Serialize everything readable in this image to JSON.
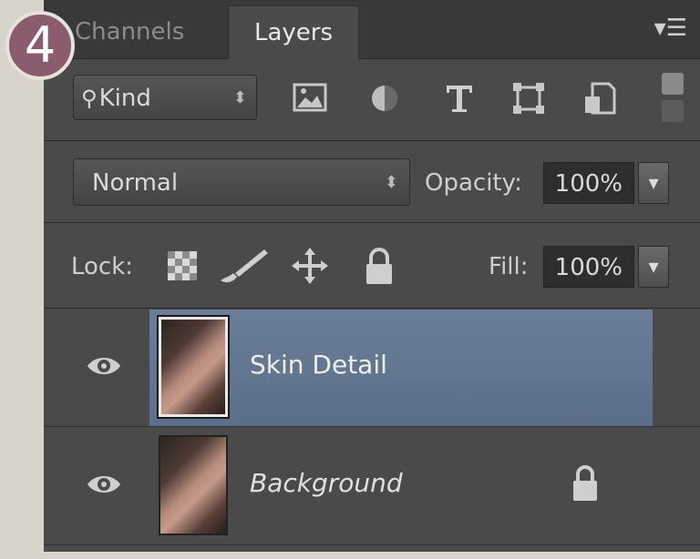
{
  "step_badge": "4",
  "tabs": [
    {
      "label": "Channels",
      "active": false
    },
    {
      "label": "Layers",
      "active": true
    }
  ],
  "panel_menu_icon": "panel-menu-icon",
  "filter": {
    "kind_label": "Kind",
    "icons": [
      "pixel-layer-filter-icon",
      "adjustment-layer-filter-icon",
      "type-layer-filter-icon",
      "shape-layer-filter-icon",
      "smart-object-filter-icon"
    ]
  },
  "blend": {
    "mode": "Normal",
    "opacity_label": "Opacity:",
    "opacity_value": "100%"
  },
  "lock": {
    "label": "Lock:",
    "icons": [
      "lock-transparent-pixels-icon",
      "lock-image-pixels-icon",
      "lock-position-icon",
      "lock-all-icon"
    ],
    "fill_label": "Fill:",
    "fill_value": "100%"
  },
  "layers": [
    {
      "name": "Skin Detail",
      "selected": true,
      "visible": true,
      "locked": false
    },
    {
      "name": "Background",
      "selected": false,
      "visible": true,
      "locked": true
    }
  ],
  "colors": {
    "panel_bg": "#4a4a4a",
    "selected_row": "#6a7e99",
    "badge": "#8b5b6e"
  }
}
